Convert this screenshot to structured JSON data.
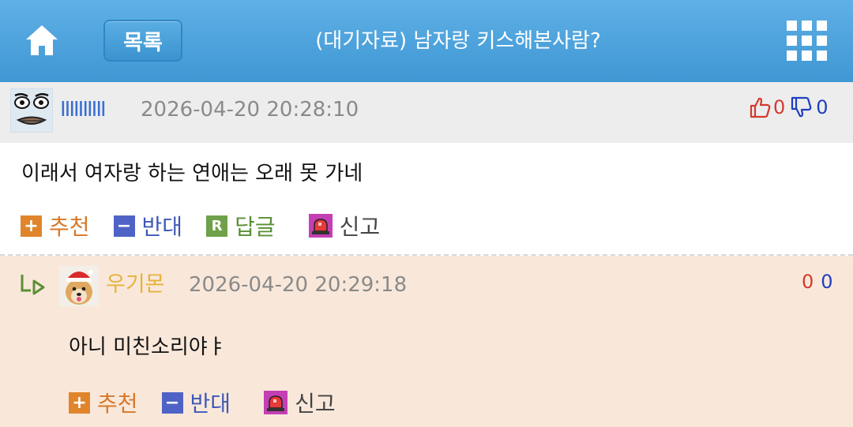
{
  "header": {
    "home_icon": "home-icon",
    "list_label": "목록",
    "title": "(대기자료) 남자랑 키스해본사람?",
    "menu_icon": "grid-menu-icon"
  },
  "comments": [
    {
      "nickname": "IIIIIIIIII",
      "timestamp": "2026-04-20 20:28:10",
      "upvotes": "0",
      "downvotes": "0",
      "body": "이래서 여자랑 하는 연애는 오래 못 가네",
      "actions": {
        "recommend": "추천",
        "oppose": "반대",
        "reply": "답글",
        "report": "신고"
      },
      "colors": {
        "nickname": "#3b6fd1",
        "background": "#ededed"
      }
    },
    {
      "nickname": "우기몬",
      "timestamp": "2026-04-20 20:29:18",
      "upvotes": "0",
      "downvotes": "0",
      "body": "아니 미친소리야ㅑ",
      "actions": {
        "recommend": "추천",
        "oppose": "반대",
        "report": "신고"
      },
      "colors": {
        "nickname": "#e8b23a",
        "background": "#f9e8da"
      }
    }
  ],
  "icons": {
    "thumbs_up": "thumbs-up-icon",
    "thumbs_down": "thumbs-down-icon",
    "reply_arrow": "reply-arrow-icon",
    "report": "siren-icon"
  },
  "colors": {
    "header": "#4aa2dc",
    "recommend": "#e0852b",
    "oppose": "#4f63c7",
    "reply": "#6ea14a",
    "report": "#c43fb3"
  }
}
